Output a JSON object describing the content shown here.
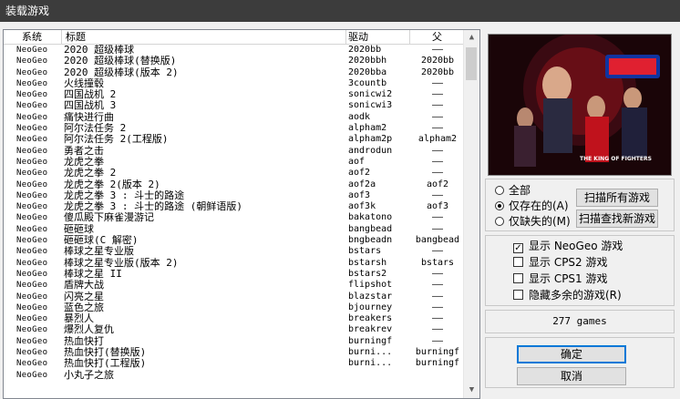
{
  "window": {
    "title": "装载游戏"
  },
  "list": {
    "columns": {
      "system": "系统",
      "title": "标题",
      "driver": "驱动",
      "parent": "父"
    },
    "rows": [
      {
        "system": "NeoGeo",
        "title": "2020 超级棒球",
        "driver": "2020bb",
        "parent": "——"
      },
      {
        "system": "NeoGeo",
        "title": "2020 超级棒球(替换版)",
        "driver": "2020bbh",
        "parent": "2020bb"
      },
      {
        "system": "NeoGeo",
        "title": "2020 超级棒球(版本 2)",
        "driver": "2020bba",
        "parent": "2020bb"
      },
      {
        "system": "NeoGeo",
        "title": "火线撞毂",
        "driver": "3countb",
        "parent": "——"
      },
      {
        "system": "NeoGeo",
        "title": "四国战机 2",
        "driver": "sonicwi2",
        "parent": "——"
      },
      {
        "system": "NeoGeo",
        "title": "四国战机 3",
        "driver": "sonicwi3",
        "parent": "——"
      },
      {
        "system": "NeoGeo",
        "title": "痛快进行曲",
        "driver": "aodk",
        "parent": "——"
      },
      {
        "system": "NeoGeo",
        "title": "阿尔法任务 2",
        "driver": "alpham2",
        "parent": "——"
      },
      {
        "system": "NeoGeo",
        "title": "阿尔法任务 2(工程版)",
        "driver": "alpham2p",
        "parent": "alpham2"
      },
      {
        "system": "NeoGeo",
        "title": "勇者之击",
        "driver": "androdun",
        "parent": "——"
      },
      {
        "system": "NeoGeo",
        "title": "龙虎之拳",
        "driver": "aof",
        "parent": "——"
      },
      {
        "system": "NeoGeo",
        "title": "龙虎之拳 2",
        "driver": "aof2",
        "parent": "——"
      },
      {
        "system": "NeoGeo",
        "title": "龙虎之拳 2(版本 2)",
        "driver": "aof2a",
        "parent": "aof2"
      },
      {
        "system": "NeoGeo",
        "title": "龙虎之拳 3 : 斗士的路途",
        "driver": "aof3",
        "parent": "——"
      },
      {
        "system": "NeoGeo",
        "title": "龙虎之拳 3 : 斗士的路途 (朝鲜语版)",
        "driver": "aof3k",
        "parent": "aof3"
      },
      {
        "system": "NeoGeo",
        "title": "傻瓜殿下麻雀漫游记",
        "driver": "bakatono",
        "parent": "——"
      },
      {
        "system": "NeoGeo",
        "title": "砸砸球",
        "driver": "bangbead",
        "parent": "——"
      },
      {
        "system": "NeoGeo",
        "title": "砸砸球(C 解密)",
        "driver": "bngbeadn",
        "parent": "bangbead"
      },
      {
        "system": "NeoGeo",
        "title": "棒球之星专业版",
        "driver": "bstars",
        "parent": "——"
      },
      {
        "system": "NeoGeo",
        "title": "棒球之星专业版(版本 2)",
        "driver": "bstarsh",
        "parent": "bstars"
      },
      {
        "system": "NeoGeo",
        "title": "棒球之星 II",
        "driver": "bstars2",
        "parent": "——"
      },
      {
        "system": "NeoGeo",
        "title": "盾牌大战",
        "driver": "flipshot",
        "parent": "——"
      },
      {
        "system": "NeoGeo",
        "title": "闪亮之星",
        "driver": "blazstar",
        "parent": "——"
      },
      {
        "system": "NeoGeo",
        "title": "蓝色之旅",
        "driver": "bjourney",
        "parent": "——"
      },
      {
        "system": "NeoGeo",
        "title": "暴烈人",
        "driver": "breakers",
        "parent": "——"
      },
      {
        "system": "NeoGeo",
        "title": "爆烈人复仇",
        "driver": "breakrev",
        "parent": "——"
      },
      {
        "system": "NeoGeo",
        "title": "热血快打",
        "driver": "burningf",
        "parent": "——"
      },
      {
        "system": "NeoGeo",
        "title": "热血快打(替换版)",
        "driver": "burni...",
        "parent": "burningf"
      },
      {
        "system": "NeoGeo",
        "title": "热血快打(工程版)",
        "driver": "burni...",
        "parent": "burningf"
      },
      {
        "system": "NeoGeo",
        "title": "小丸子之旅",
        "driver": "",
        "parent": ""
      }
    ]
  },
  "preview": {
    "logo_text": "THE KING OF FIGHTERS",
    "colors": {
      "bg": "#1a0508",
      "red": "#c0121c",
      "sky": "#3a0a12"
    }
  },
  "filter": {
    "options": [
      {
        "label": "全部",
        "selected": false
      },
      {
        "label": "仅存在的(A)",
        "selected": true
      },
      {
        "label": "仅缺失的(M)",
        "selected": false
      }
    ],
    "scan_all_button": "扫描所有游戏",
    "scan_new_button": "扫描查找新游戏"
  },
  "show": {
    "items": [
      {
        "label": "显示 NeoGeo 游戏",
        "checked": true
      },
      {
        "label": "显示 CPS2 游戏",
        "checked": false
      },
      {
        "label": "显示 CPS1 游戏",
        "checked": false
      },
      {
        "label": "隐藏多余的游戏(R)",
        "checked": false
      }
    ]
  },
  "count_text": "277 games",
  "buttons": {
    "ok": "确定",
    "cancel": "取消"
  }
}
